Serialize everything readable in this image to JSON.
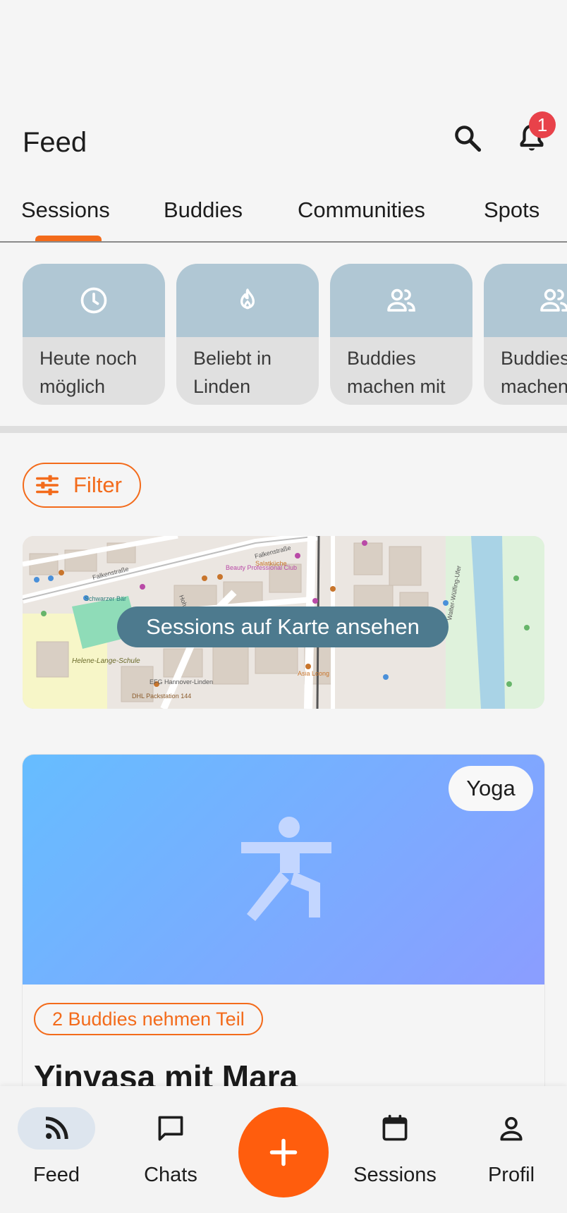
{
  "header": {
    "title": "Feed",
    "notification_count": "1"
  },
  "tabs": [
    {
      "label": "Sessions",
      "active": true
    },
    {
      "label": "Buddies",
      "active": false
    },
    {
      "label": "Communities",
      "active": false
    },
    {
      "label": "Spots",
      "active": false
    }
  ],
  "quick_filters": [
    {
      "icon": "clock-icon",
      "label": "Heute noch möglich"
    },
    {
      "icon": "fire-icon",
      "label": "Beliebt in Linden"
    },
    {
      "icon": "people-icon",
      "label": "Buddies machen mit"
    },
    {
      "icon": "people-icon",
      "label": "Buddies machen mit"
    }
  ],
  "filter": {
    "label": "Filter"
  },
  "map": {
    "button_label": "Sessions auf Karte ansehen",
    "labels": {
      "falkenstrasse": "Falkenstraße",
      "hohe_strasse": "Hohe Straße",
      "beauty": "Beauty Professional Club",
      "salatkueche": "Salatküche",
      "schwarzer_bar": "Schwarzer Bär",
      "helene": "Helene-Lange-Schule",
      "efg": "EFG Hannover-Linden",
      "dhl": "DHL Packstation 144",
      "asia": "Asia Loong",
      "walter": "Walter-Wülfing-Ufer"
    }
  },
  "session": {
    "tag": "Yoga",
    "buddies_badge": "2 Buddies nehmen Teil",
    "title": "Yinyasa mit Mara"
  },
  "bottom_nav": {
    "feed": "Feed",
    "chats": "Chats",
    "sessions": "Sessions",
    "profile": "Profil"
  },
  "colors": {
    "accent": "#f36b1b",
    "fab": "#ff5d0d",
    "badge": "#e8424a",
    "map_button": "#4d7a8e"
  }
}
